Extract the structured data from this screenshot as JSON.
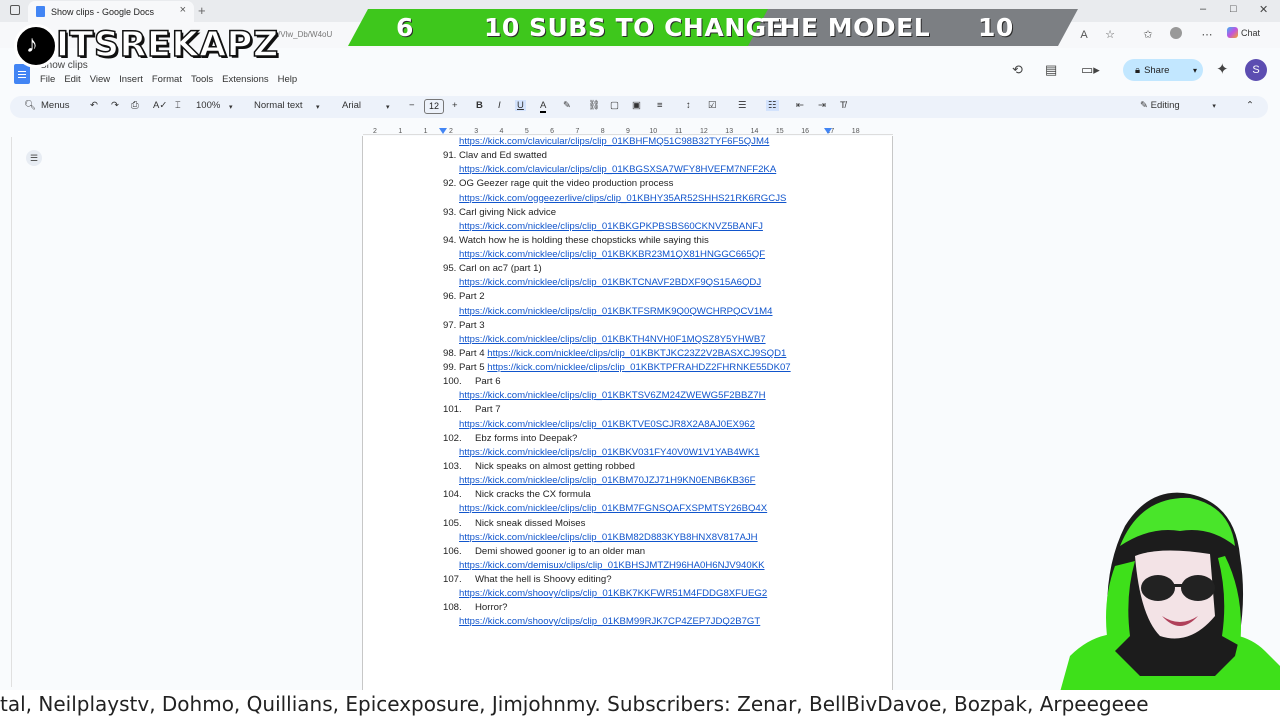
{
  "browser": {
    "tab_title": "Show clips - Google Docs",
    "address_fragment": "/Vlw_Db/W4oU",
    "chat_label": "Chat"
  },
  "overlay": {
    "channel_name": "ITSREKAPZ",
    "banner_left_number": "6",
    "banner_text_a": "10 SUBS TO CHANGE",
    "banner_text_b": "THE MODEL",
    "banner_right_number": "10",
    "ticker": "tal, Neilplaystv, Dohmo, Quillians, Epicexposure, Jimjohnmy.  Subscribers: Zenar, BellBivDavoe, Bozpak, Arpeegeee"
  },
  "docs": {
    "title": "Show clips",
    "menu": [
      "File",
      "Edit",
      "View",
      "Insert",
      "Format",
      "Tools",
      "Extensions",
      "Help"
    ],
    "share_label": "Share",
    "avatar_initial": "S",
    "toolbar": {
      "search_label": "Menus",
      "zoom": "100%",
      "style": "Normal text",
      "font": "Arial",
      "font_size": "12",
      "mode": "Editing"
    },
    "ruler_labels": [
      "2",
      "1",
      "1",
      "2",
      "3",
      "4",
      "5",
      "6",
      "7",
      "8",
      "9",
      "10",
      "11",
      "12",
      "13",
      "14",
      "15",
      "16",
      "17",
      "18"
    ]
  },
  "doc_lines": [
    {
      "num": "",
      "text": "",
      "link": "https://kick.com/clavicular/clips/clip_01KBHFMQ51C98B32TYF6F5QJM4"
    },
    {
      "num": "91.",
      "text": "Clav and Ed swatted",
      "link": ""
    },
    {
      "num": "",
      "text": "",
      "link": "https://kick.com/clavicular/clips/clip_01KBGSXSA7WFY8HVEFM7NFF2KA"
    },
    {
      "num": "92.",
      "text": "OG Geezer rage quit the video production process",
      "link": ""
    },
    {
      "num": "",
      "text": "",
      "link": "https://kick.com/oggeezerlive/clips/clip_01KBHY35AR52SHHS21RK6RGCJS"
    },
    {
      "num": "93.",
      "text": "Carl giving Nick advice",
      "link": ""
    },
    {
      "num": "",
      "text": "",
      "link": "https://kick.com/nicklee/clips/clip_01KBKGPKPBSBS60CKNVZ5BANFJ"
    },
    {
      "num": "94.",
      "text": "Watch how he is holding these chopsticks while saying this",
      "link": ""
    },
    {
      "num": "",
      "text": "",
      "link": "https://kick.com/nicklee/clips/clip_01KBKKBR23M1QX81HNGGC665QF"
    },
    {
      "num": "95.",
      "text": "Carl on ac7 (part 1)",
      "link": ""
    },
    {
      "num": "",
      "text": "",
      "link": "https://kick.com/nicklee/clips/clip_01KBKTCNAVF2BDXF9QS15A6QDJ"
    },
    {
      "num": "96.",
      "text": "Part 2",
      "link": ""
    },
    {
      "num": "",
      "text": "",
      "link": "https://kick.com/nicklee/clips/clip_01KBKTFSRMK9Q0QWCHRPQCV1M4"
    },
    {
      "num": "97.",
      "text": "Part 3",
      "link": ""
    },
    {
      "num": "",
      "text": "",
      "link": "https://kick.com/nicklee/clips/clip_01KBKTH4NVH0F1MQSZ8Y5YHWB7"
    },
    {
      "num": "98.",
      "text": "Part 4 ",
      "link": "https://kick.com/nicklee/clips/clip_01KBKTJKC23Z2V2BASXCJ9SQD1"
    },
    {
      "num": "99.",
      "text": "Part 5 ",
      "link": "https://kick.com/nicklee/clips/clip_01KBKTPFRAHDZ2FHRNKE55DK07"
    },
    {
      "num": "100.",
      "text": "Part 6",
      "link": ""
    },
    {
      "num": "",
      "text": "",
      "link": "https://kick.com/nicklee/clips/clip_01KBKTSV6ZM24ZWEWG5F2BBZ7H"
    },
    {
      "num": "101.",
      "text": "Part 7",
      "link": ""
    },
    {
      "num": "",
      "text": "",
      "link": "https://kick.com/nicklee/clips/clip_01KBKTVE0SCJR8X2A8AJ0EX962"
    },
    {
      "num": "102.",
      "text": "Ebz forms into Deepak?",
      "link": ""
    },
    {
      "num": "",
      "text": "",
      "link": "https://kick.com/nicklee/clips/clip_01KBKV031FY40V0W1V1YAB4WK1"
    },
    {
      "num": "103.",
      "text": "Nick speaks on almost getting robbed",
      "link": ""
    },
    {
      "num": "",
      "text": "",
      "link": "https://kick.com/nicklee/clips/clip_01KBM70JZJ71H9KN0ENB6KB36F"
    },
    {
      "num": "104.",
      "text": "Nick cracks the CX formula",
      "link": ""
    },
    {
      "num": "",
      "text": "",
      "link": "https://kick.com/nicklee/clips/clip_01KBM7FGNSQAFXSPMTSY26BQ4X"
    },
    {
      "num": "105.",
      "text": "Nick sneak dissed Moises",
      "link": ""
    },
    {
      "num": "",
      "text": "",
      "link": "https://kick.com/nicklee/clips/clip_01KBM82D883KYB8HNX8V817AJH"
    },
    {
      "num": "106.",
      "text": "Demi showed gooner ig to an older man",
      "link": ""
    },
    {
      "num": "",
      "text": "",
      "link": "https://kick.com/demisux/clips/clip_01KBHSJMTZH96HA0H6NJV940KK"
    },
    {
      "num": "107.",
      "text": "What the hell is Shoovy editing?",
      "link": ""
    },
    {
      "num": "",
      "text": "",
      "link": "https://kick.com/shoovy/clips/clip_01KBK7KKFWR51M4FDDG8XFUEG2"
    },
    {
      "num": "108.",
      "text": "Horror?",
      "link": ""
    },
    {
      "num": "",
      "text": "",
      "link": "https://kick.com/shoovy/clips/clip_01KBM99RJK7CP4ZEP7JDQ2B7GT"
    }
  ]
}
